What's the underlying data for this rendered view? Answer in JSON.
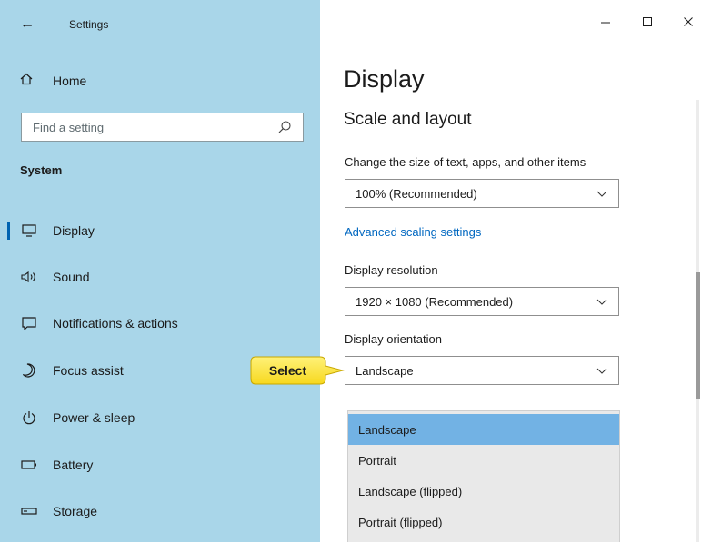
{
  "window": {
    "title": "Settings",
    "back_icon": "back-arrow-icon",
    "controls": {
      "minimize": "minimize-icon",
      "maximize": "maximize-icon",
      "close": "close-icon"
    }
  },
  "sidebar": {
    "home_label": "Home",
    "search": {
      "placeholder": "Find a setting"
    },
    "section_heading": "System",
    "items": [
      {
        "label": "Display",
        "icon": "monitor-icon",
        "selected": true
      },
      {
        "label": "Sound",
        "icon": "speaker-icon"
      },
      {
        "label": "Notifications & actions",
        "icon": "message-icon"
      },
      {
        "label": "Focus assist",
        "icon": "moon-icon"
      },
      {
        "label": "Power & sleep",
        "icon": "power-icon"
      },
      {
        "label": "Battery",
        "icon": "battery-icon"
      },
      {
        "label": "Storage",
        "icon": "storage-icon"
      }
    ]
  },
  "main": {
    "title": "Display",
    "section_heading": "Scale and layout",
    "scale": {
      "label": "Change the size of text, apps, and other items",
      "value": "100% (Recommended)"
    },
    "advanced_link": "Advanced scaling settings",
    "resolution": {
      "label": "Display resolution",
      "value": "1920 × 1080 (Recommended)"
    },
    "orientation": {
      "label": "Display orientation",
      "value": "Landscape",
      "options": [
        "Landscape",
        "Portrait",
        "Landscape (flipped)",
        "Portrait (flipped)"
      ],
      "highlighted": "Landscape"
    }
  },
  "annotation": {
    "callout_text": "Select"
  },
  "colors": {
    "sidebar_bg": "#a9d6e9",
    "accent": "#0063b1",
    "link": "#0067c0",
    "list_highlight": "#72b2e4",
    "callout": "#ffe94d"
  }
}
